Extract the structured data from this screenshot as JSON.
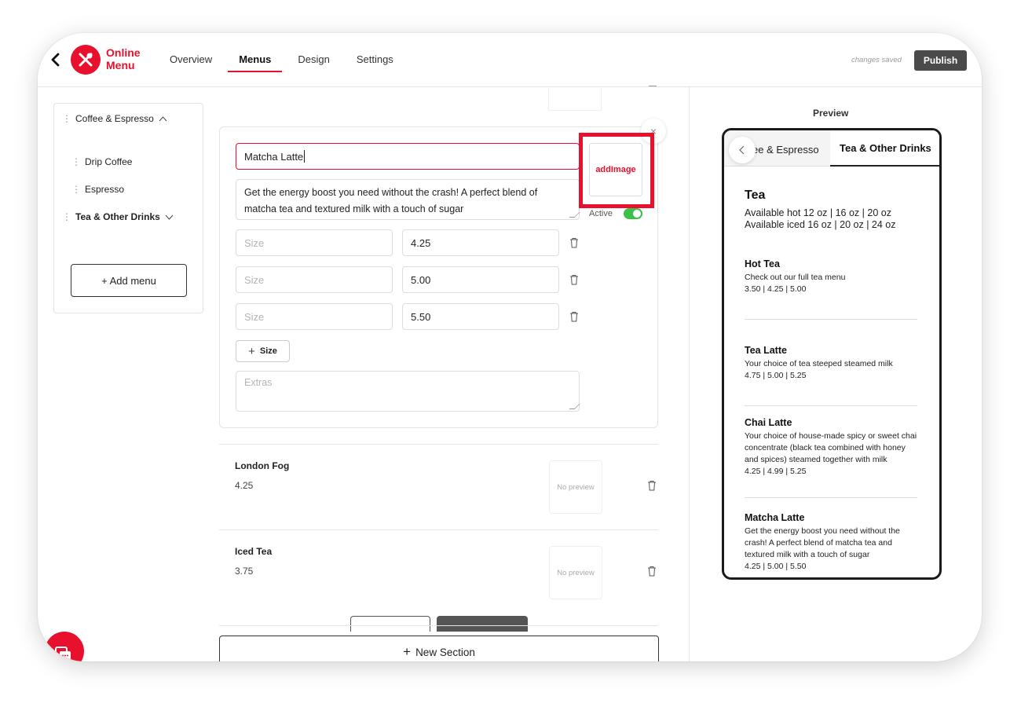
{
  "header": {
    "logo_text_line1": "Online",
    "logo_text_line2": "Menu",
    "tabs": [
      "Overview",
      "Menus",
      "Design",
      "Settings"
    ],
    "active_tab": "Menus",
    "status": "changes saved",
    "publish_label": "Publish"
  },
  "sidebar": {
    "items": [
      {
        "label": "Coffee & Espresso",
        "level": 0,
        "expanded": true
      },
      {
        "label": "Drip Coffee",
        "level": 1
      },
      {
        "label": "Espresso",
        "level": 1
      },
      {
        "label": "Tea & Other Drinks",
        "level": 0,
        "expanded": false
      }
    ],
    "add_menu_label": "+ Add menu"
  },
  "editor": {
    "name_value": "Matcha Latte",
    "description_value": "Get the energy boost you need without the crash! A perfect blend of matcha tea and textured milk with a touch of sugar",
    "sizes": [
      {
        "size_placeholder": "Size",
        "price": "4.25"
      },
      {
        "size_placeholder": "Size",
        "price": "5.00"
      },
      {
        "size_placeholder": "Size",
        "price": "5.50"
      }
    ],
    "add_size_label": "Size",
    "extras_placeholder": "Extras",
    "image_button_label": "addImage",
    "active_label": "Active",
    "active": true,
    "close_icon": "×"
  },
  "items": [
    {
      "name": "London Fog",
      "price": "4.25",
      "preview": "No preview"
    },
    {
      "name": "Iced Tea",
      "price": "3.75",
      "preview": "No preview"
    }
  ],
  "new_section_label": "New Section",
  "preview": {
    "label": "Preview",
    "tabs": [
      "ee & Espresso",
      "Tea & Other Drinks"
    ],
    "section_title": "Tea",
    "section_sub_line1": "Available hot 12 oz | 16 oz | 20 oz",
    "section_sub_line2": "Available iced 16 oz | 20 oz | 24 oz",
    "items": [
      {
        "name": "Hot Tea",
        "description": "Check out our full tea menu",
        "prices": "3.50 | 4.25 | 5.00"
      },
      {
        "name": "Tea Latte",
        "description": "Your choice of tea steeped steamed milk",
        "prices": "4.75 | 5.00 | 5.25"
      },
      {
        "name": "Chai Latte",
        "description": "Your choice of house-made spicy or sweet chai concentrate (black tea combined with honey and spices) steamed together with milk",
        "prices": "4.25 | 4.99 | 5.25"
      },
      {
        "name": "Matcha Latte",
        "description": "Get the energy boost you need without the crash! A perfect blend of matcha tea and textured milk with a touch of sugar",
        "prices": "4.25 | 5.00 | 5.50"
      }
    ]
  },
  "colors": {
    "brand": "#e8112d",
    "toggle_on": "#3cc04a",
    "publish_bg": "#4a4a4a"
  }
}
